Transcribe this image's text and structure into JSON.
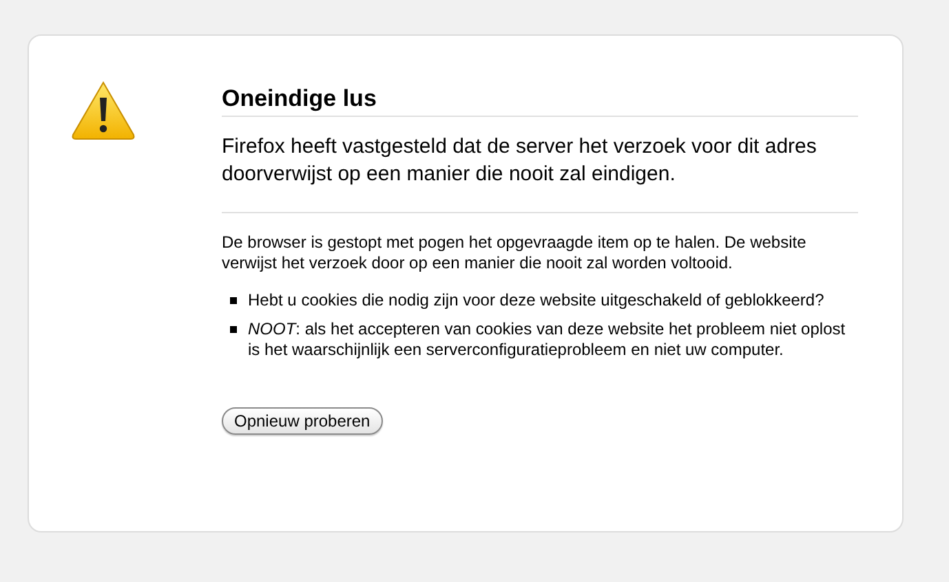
{
  "title": "Oneindige lus",
  "lead": "Firefox heeft vastgesteld dat de server het verzoek voor dit adres doorverwijst op een manier die nooit zal eindigen.",
  "description": "De browser is gestopt met pogen het opgevraagde item op te halen. De website verwijst het verzoek door op een manier die nooit zal worden voltooid.",
  "suggestions": [
    "Hebt u cookies die nodig zijn voor deze website uitgeschakeld of geblokkeerd?",
    "*NOOT*: als het accepteren van cookies van deze website het probleem niet oplost is het waarschijnlijk een serverconfiguratieprobleem en niet uw computer."
  ],
  "button": "Opnieuw proberen"
}
